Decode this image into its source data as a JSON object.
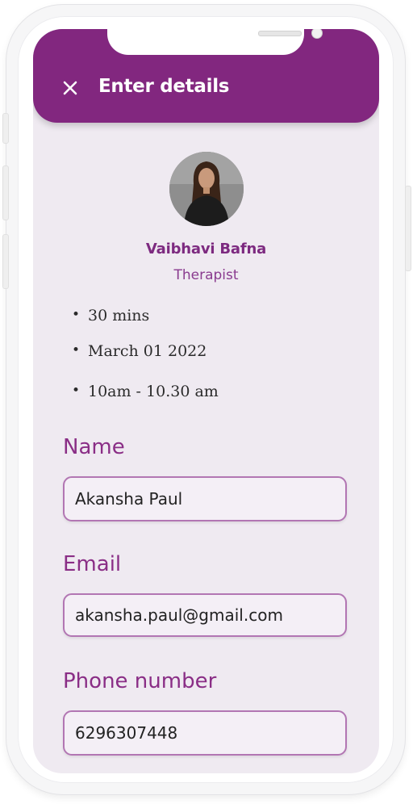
{
  "app_bar": {
    "title": "Enter details",
    "close_icon": "close-icon",
    "background_color": "#82277f"
  },
  "therapist": {
    "name": "Vaibhavi Bafna",
    "role": "Therapist"
  },
  "session_details": [
    "30 mins",
    "March 01 2022",
    "10am - 10.30 am"
  ],
  "form": {
    "name_label": "Name",
    "name_value": "Akansha Paul",
    "email_label": "Email",
    "email_value": "akansha.paul@gmail.com",
    "phone_label": "Phone number",
    "phone_value": "6296307448"
  },
  "colors": {
    "accent": "#82277f",
    "screen_background": "#efeaf1",
    "input_border": "#b276b3"
  }
}
